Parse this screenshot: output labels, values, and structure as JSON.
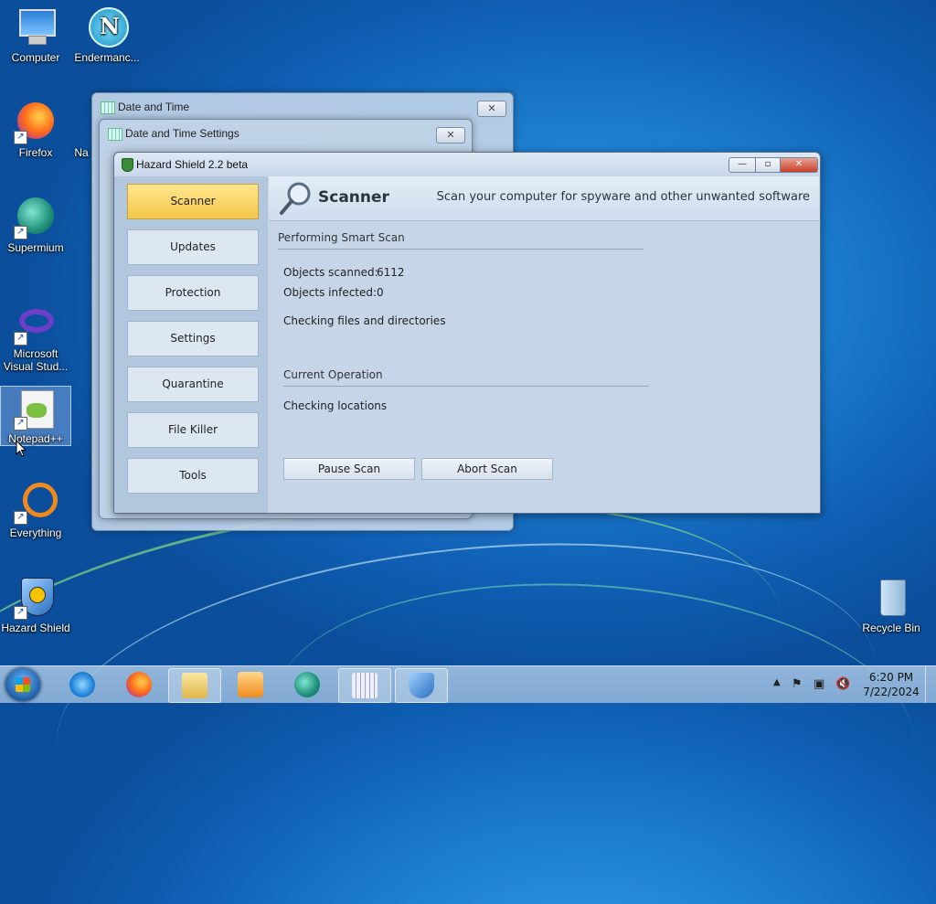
{
  "desktop": {
    "icons": [
      {
        "label": "Computer"
      },
      {
        "label": "Endermanc..."
      },
      {
        "label": "Firefox"
      },
      {
        "label": "Na"
      },
      {
        "label": "Supermium"
      },
      {
        "label": "Microsoft Visual Stud..."
      },
      {
        "label": "Notepad++"
      },
      {
        "label": "Everything"
      },
      {
        "label": "Hazard Shield"
      },
      {
        "label": "Recycle Bin"
      }
    ]
  },
  "bg_windows": {
    "date_time": {
      "title": "Date and Time"
    },
    "date_time_settings": {
      "title": "Date and Time Settings"
    }
  },
  "hazard_shield": {
    "title": "Hazard Shield 2.2 beta",
    "nav": [
      {
        "label": "Scanner",
        "active": true
      },
      {
        "label": "Updates"
      },
      {
        "label": "Protection"
      },
      {
        "label": "Settings"
      },
      {
        "label": "Quarantine"
      },
      {
        "label": "File Killer"
      },
      {
        "label": "Tools"
      }
    ],
    "header": {
      "title": "Scanner",
      "subtitle": "Scan your computer for spyware and other unwanted software"
    },
    "scan": {
      "section_title": "Performing Smart Scan",
      "objects_scanned_label": "Objects scanned:",
      "objects_scanned_value": "6112",
      "objects_infected_label": "Objects infected:",
      "objects_infected_value": "0",
      "status": "Checking files and directories",
      "current_op_title": "Current Operation",
      "current_op_value": "Checking locations"
    },
    "buttons": {
      "pause": "Pause Scan",
      "abort": "Abort Scan"
    },
    "accent_color": "#f4c84c"
  },
  "taskbar": {
    "pinned": [
      "start-button",
      "internet-explorer",
      "firefox",
      "file-explorer",
      "media-player",
      "supermium",
      "date-time-settings",
      "hazard-shield"
    ],
    "clock": {
      "time": "6:20 PM",
      "date": "7/22/2024"
    }
  }
}
